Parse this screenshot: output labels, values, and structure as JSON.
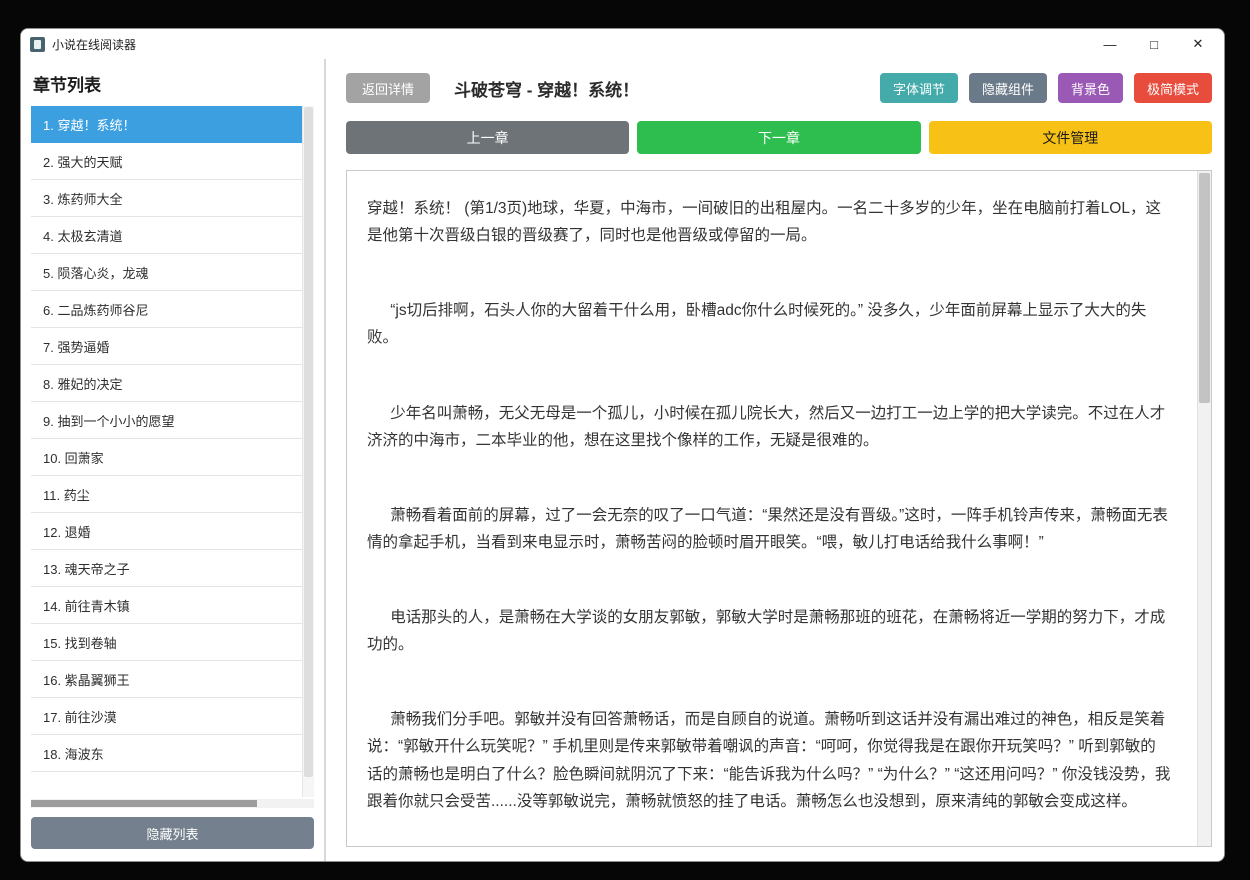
{
  "window": {
    "title": "小说在线阅读器",
    "controls": {
      "minimize_glyph": "—",
      "maximize_glyph": "□",
      "close_glyph": "✕"
    }
  },
  "sidebar": {
    "header": "章节列表",
    "selected_bg": "#3b9fe0",
    "selected_fg": "#ffffff",
    "chapters": [
      {
        "label": "1. 穿越！系统！",
        "selected": true
      },
      {
        "label": "2. 强大的天赋",
        "selected": false
      },
      {
        "label": "3. 炼药师大全",
        "selected": false
      },
      {
        "label": "4. 太极玄清道",
        "selected": false
      },
      {
        "label": "5. 陨落心炎，龙魂",
        "selected": false
      },
      {
        "label": "6. 二品炼药师谷尼",
        "selected": false
      },
      {
        "label": "7. 强势逼婚",
        "selected": false
      },
      {
        "label": "8. 雅妃的决定",
        "selected": false
      },
      {
        "label": "9. 抽到一个小小的愿望",
        "selected": false
      },
      {
        "label": "10. 回萧家",
        "selected": false
      },
      {
        "label": "11. 药尘",
        "selected": false
      },
      {
        "label": "12. 退婚",
        "selected": false
      },
      {
        "label": "13. 魂天帝之子",
        "selected": false
      },
      {
        "label": "14. 前往青木镇",
        "selected": false
      },
      {
        "label": "15. 找到卷轴",
        "selected": false
      },
      {
        "label": "16. 紫晶翼狮王",
        "selected": false
      },
      {
        "label": "17. 前往沙漠",
        "selected": false
      },
      {
        "label": "18. 海波东",
        "selected": false
      }
    ],
    "hide_list": {
      "label": "隐藏列表",
      "bg": "#74808d",
      "fg": "#ffffff"
    }
  },
  "main": {
    "back": {
      "label": "返回详情",
      "bg": "#a3a3a3",
      "fg": "#ffffff"
    },
    "title": "斗破苍穹 - 穿越！系统！",
    "toolbar": [
      {
        "label": "字体调节",
        "bg": "#44aaaa",
        "fg": "#ffffff"
      },
      {
        "label": "隐藏组件",
        "bg": "#6b7a88",
        "fg": "#ffffff"
      },
      {
        "label": "背景色",
        "bg": "#9b59b6",
        "fg": "#ffffff"
      },
      {
        "label": "极简模式",
        "bg": "#e74c3c",
        "fg": "#ffffff"
      }
    ],
    "nav": [
      {
        "label": "上一章",
        "bg": "#6e7377",
        "fg": "#ffffff"
      },
      {
        "label": "下一章",
        "bg": "#2ebd4f",
        "fg": "#ffffff"
      },
      {
        "label": "文件管理",
        "bg": "#f7c116",
        "fg": "#1a1a1a"
      }
    ],
    "page_indicator": "第1/3页",
    "paragraphs": [
      {
        "indent": false,
        "text": "穿越！系统！ (第1/3页)地球，华夏，中海市，一间破旧的出租屋内。一名二十多岁的少年，坐在电脑前打着LOL，这是他第十次晋级白银的晋级赛了，同时也是他晋级或停留的一局。"
      },
      {
        "indent": true,
        "text": "“js切后排啊，石头人你的大留着干什么用，卧槽adc你什么时候死的。” 没多久，少年面前屏幕上显示了大大的失败。"
      },
      {
        "indent": true,
        "text": "少年名叫萧畅，无父无母是一个孤儿，小时候在孤儿院长大，然后又一边打工一边上学的把大学读完。不过在人才济济的中海市，二本毕业的他，想在这里找个像样的工作，无疑是很难的。"
      },
      {
        "indent": true,
        "text": "萧畅看着面前的屏幕，过了一会无奈的叹了一口气道：“果然还是没有晋级。”这时，一阵手机铃声传来，萧畅面无表情的拿起手机，当看到来电显示时，萧畅苦闷的脸顿时眉开眼笑。“喂，敏儿打电话给我什么事啊！”"
      },
      {
        "indent": true,
        "text": "电话那头的人，是萧畅在大学谈的女朋友郭敏，郭敏大学时是萧畅那班的班花，在萧畅将近一学期的努力下，才成功的。"
      },
      {
        "indent": true,
        "text": "萧畅我们分手吧。郭敏并没有回答萧畅话，而是自顾自的说道。萧畅听到这话并没有漏出难过的神色，相反是笑着说：“郭敏开什么玩笑呢？” 手机里则是传来郭敏带着嘲讽的声音：“呵呵，你觉得我是在跟你开玩笑吗？” 听到郭敏的话的萧畅也是明白了什么？脸色瞬间就阴沉了下来：“能告诉我为什么吗？” “为什么？” “这还用问吗？” 你没钱没势，我跟着你就只会受苦......没等郭敏说完，萧畅就愤怒的挂了电话。萧畅怎么也没想到，原来清纯的郭敏会变成这样。"
      }
    ]
  }
}
